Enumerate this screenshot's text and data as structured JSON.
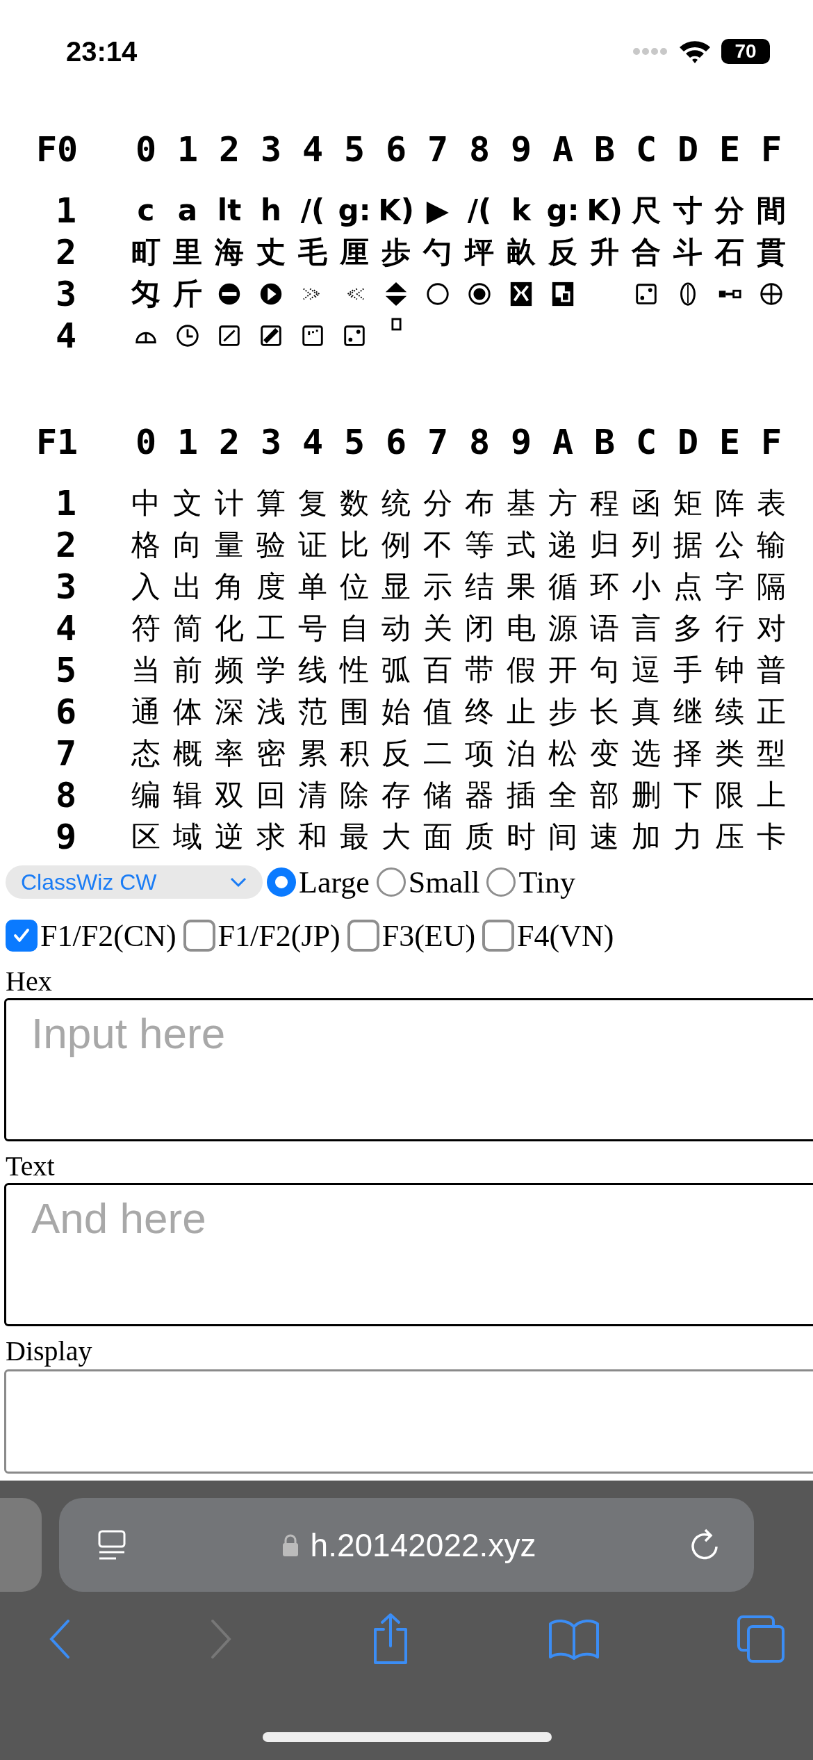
{
  "status_bar": {
    "time": "23:14",
    "battery": "70"
  },
  "tables": [
    {
      "title": "F0",
      "columns": [
        "0",
        "1",
        "2",
        "3",
        "4",
        "5",
        "6",
        "7",
        "8",
        "9",
        "A",
        "B",
        "C",
        "D",
        "E",
        "F"
      ],
      "rows": [
        {
          "label": "1",
          "cells": [
            "c",
            "a",
            "lt",
            "h",
            "/(",
            "g:",
            "K)",
            "▶",
            "/(",
            "k",
            "g:",
            "K)",
            "尺",
            "寸",
            "分",
            "間"
          ]
        },
        {
          "label": "2",
          "cells": [
            "町",
            "里",
            "海",
            "丈",
            "毛",
            "厘",
            "歩",
            "勺",
            "坪",
            "畝",
            "反",
            "升",
            "合",
            "斗",
            "石",
            "貫"
          ]
        },
        {
          "label": "3",
          "cells": [
            "匁",
            "斤",
            {
              "kind": "icon"
            },
            {
              "kind": "icon"
            },
            {
              "kind": "icon"
            },
            {
              "kind": "icon"
            },
            {
              "kind": "icon"
            },
            {
              "kind": "icon"
            },
            {
              "kind": "icon"
            },
            {
              "kind": "icon"
            },
            {
              "kind": "icon"
            },
            {
              "kind": "empty"
            },
            {
              "kind": "icon"
            },
            {
              "kind": "icon"
            },
            {
              "kind": "icon"
            },
            {
              "kind": "icon"
            }
          ]
        },
        {
          "label": "4",
          "cells": [
            {
              "kind": "icon"
            },
            {
              "kind": "icon"
            },
            {
              "kind": "icon"
            },
            {
              "kind": "icon"
            },
            {
              "kind": "icon"
            },
            {
              "kind": "icon"
            },
            {
              "kind": "icon"
            }
          ]
        }
      ]
    },
    {
      "title": "F1",
      "columns": [
        "0",
        "1",
        "2",
        "3",
        "4",
        "5",
        "6",
        "7",
        "8",
        "9",
        "A",
        "B",
        "C",
        "D",
        "E",
        "F"
      ],
      "rows": [
        {
          "label": "1",
          "cells": [
            "中",
            "文",
            "计",
            "算",
            "复",
            "数",
            "统",
            "分",
            "布",
            "基",
            "方",
            "程",
            "函",
            "矩",
            "阵",
            "表"
          ]
        },
        {
          "label": "2",
          "cells": [
            "格",
            "向",
            "量",
            "验",
            "证",
            "比",
            "例",
            "不",
            "等",
            "式",
            "递",
            "归",
            "列",
            "据",
            "公",
            "输"
          ]
        },
        {
          "label": "3",
          "cells": [
            "入",
            "出",
            "角",
            "度",
            "单",
            "位",
            "显",
            "示",
            "结",
            "果",
            "循",
            "环",
            "小",
            "点",
            "字",
            "隔"
          ]
        },
        {
          "label": "4",
          "cells": [
            "符",
            "简",
            "化",
            "工",
            "号",
            "自",
            "动",
            "关",
            "闭",
            "电",
            "源",
            "语",
            "言",
            "多",
            "行",
            "对"
          ]
        },
        {
          "label": "5",
          "cells": [
            "当",
            "前",
            "频",
            "学",
            "线",
            "性",
            "弧",
            "百",
            "带",
            "假",
            "开",
            "句",
            "逗",
            "手",
            "钟",
            "普"
          ]
        },
        {
          "label": "6",
          "cells": [
            "通",
            "体",
            "深",
            "浅",
            "范",
            "围",
            "始",
            "值",
            "终",
            "止",
            "步",
            "长",
            "真",
            "继",
            "续",
            "正"
          ]
        },
        {
          "label": "7",
          "cells": [
            "态",
            "概",
            "率",
            "密",
            "累",
            "积",
            "反",
            "二",
            "项",
            "泊",
            "松",
            "变",
            "选",
            "择",
            "类",
            "型"
          ]
        },
        {
          "label": "8",
          "cells": [
            "编",
            "辑",
            "双",
            "回",
            "清",
            "除",
            "存",
            "储",
            "器",
            "插",
            "全",
            "部",
            "删",
            "下",
            "限",
            "上"
          ]
        },
        {
          "label": "9",
          "cells": [
            "区",
            "域",
            "逆",
            "求",
            "和",
            "最",
            "大",
            "面",
            "质",
            "时",
            "间",
            "速",
            "加",
            "力",
            "压",
            "卡"
          ]
        }
      ]
    }
  ],
  "controls": {
    "model": "ClassWiz CW",
    "sizes": [
      {
        "label": "Large",
        "selected": true
      },
      {
        "label": "Small",
        "selected": false
      },
      {
        "label": "Tiny",
        "selected": false
      }
    ],
    "charsets": [
      {
        "label": "F1/F2(CN)",
        "checked": true
      },
      {
        "label": "F1/F2(JP)",
        "checked": false
      },
      {
        "label": "F3(EU)",
        "checked": false
      },
      {
        "label": "F4(VN)",
        "checked": false
      }
    ]
  },
  "hex": {
    "label": "Hex",
    "placeholder": "Input here"
  },
  "text": {
    "label": "Text",
    "placeholder": "And here"
  },
  "display": {
    "label": "Display"
  },
  "browser": {
    "url": "h.20142022.xyz"
  }
}
